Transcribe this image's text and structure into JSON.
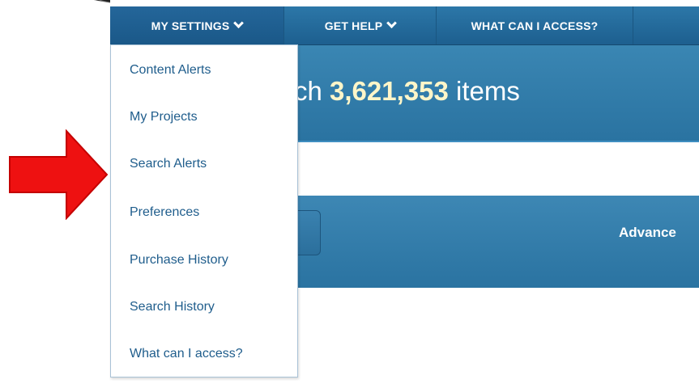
{
  "nav": {
    "items": [
      {
        "label": "MY SETTINGS",
        "has_dropdown": true,
        "active": true
      },
      {
        "label": "GET HELP",
        "has_dropdown": true,
        "active": false
      },
      {
        "label": "WHAT CAN I ACCESS?",
        "has_dropdown": false,
        "active": false
      }
    ]
  },
  "hero": {
    "prefix": "rch ",
    "count": "3,621,353",
    "suffix": " items"
  },
  "search": {
    "advanced_label": "Advance"
  },
  "settings_menu": {
    "items": [
      {
        "label": "Content Alerts"
      },
      {
        "label": "My Projects"
      },
      {
        "label": "Search Alerts",
        "highlighted_by_arrow": true
      },
      {
        "label": "Preferences"
      },
      {
        "label": "Purchase History"
      },
      {
        "label": "Search History"
      },
      {
        "label": "What can I access?"
      }
    ]
  },
  "colors": {
    "nav_blue": "#1d5f8f",
    "band_blue": "#2a73a1",
    "menu_link": "#1f5d8c",
    "count_highlight": "#fff6c9",
    "pointer_arrow": "#ee1111"
  }
}
